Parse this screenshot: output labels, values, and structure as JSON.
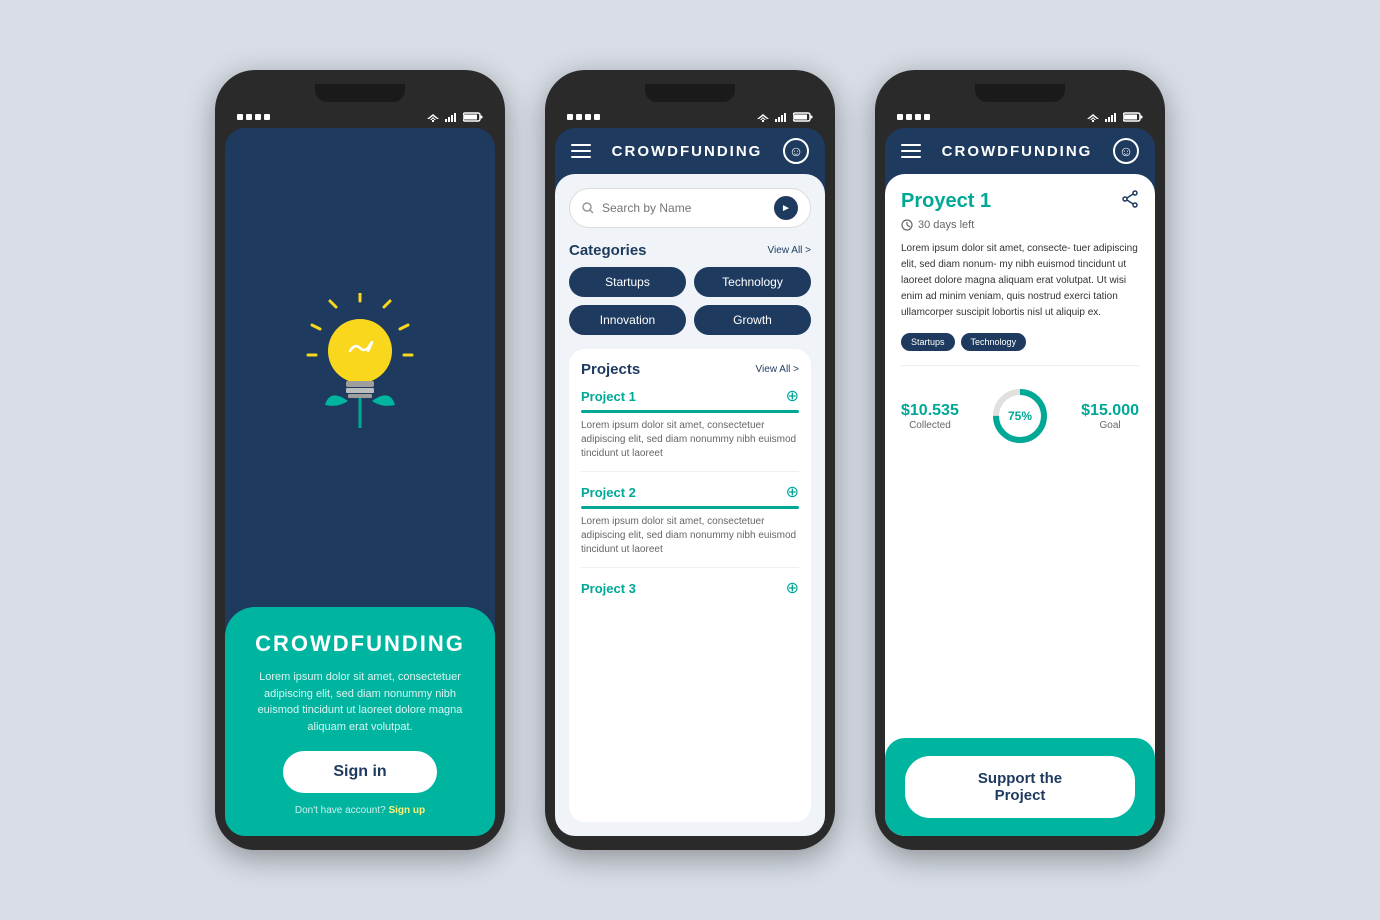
{
  "phone1": {
    "status": "●●●",
    "splashTitle": "CROWDFUNDING",
    "splashDesc": "Lorem ipsum dolor sit amet, consectetuer adipiscing elit, sed diam nonummy nibh euismod tincidunt ut laoreet dolore magna aliquam erat volutpat.",
    "signinLabel": "Sign in",
    "signupPrompt": "Don't have account?",
    "signupLink": "Sign up"
  },
  "phone2": {
    "headerTitle": "CROWDFUNDING",
    "searchPlaceholder": "Search by Name",
    "categoriesTitle": "Categories",
    "viewAllLabel": "View All >",
    "categories": [
      "Startups",
      "Technology",
      "Innovation",
      "Growth"
    ],
    "projectsTitle": "Projects",
    "projects": [
      {
        "name": "Project 1",
        "desc": "Lorem ipsum dolor sit amet, consectetuer adipiscing elit, sed diam nonummy nibh euismod tincidunt ut laoreet"
      },
      {
        "name": "Project 2",
        "desc": "Lorem ipsum dolor sit amet, consectetuer adipiscing elit, sed diam nonummy nibh euismod tincidunt ut laoreet"
      },
      {
        "name": "Project 3",
        "desc": ""
      }
    ]
  },
  "phone3": {
    "headerTitle": "CROWDFUNDING",
    "projectTitle": "Proyect 1",
    "timeLeft": "30 days left",
    "description": "Lorem ipsum dolor sit amet, consecte- tuer adipiscing elit, sed diam nonum- my nibh euismod tincidunt ut laoreet dolore magna aliquam erat volutpat. Ut wisi enim ad minim veniam, quis nostrud exerci tation ullamcorper suscipit lobortis nisl ut aliquip ex.",
    "tags": [
      "Startups",
      "Technology"
    ],
    "collected": "$10.535",
    "collectedLabel": "Collected",
    "progress": "75%",
    "goal": "$15.000",
    "goalLabel": "Goal",
    "supportBtn": "Support the Project"
  },
  "colors": {
    "dark": "#1e3a5f",
    "teal": "#00b5a0",
    "accent": "#00a896",
    "yellow": "#f9d71c"
  }
}
